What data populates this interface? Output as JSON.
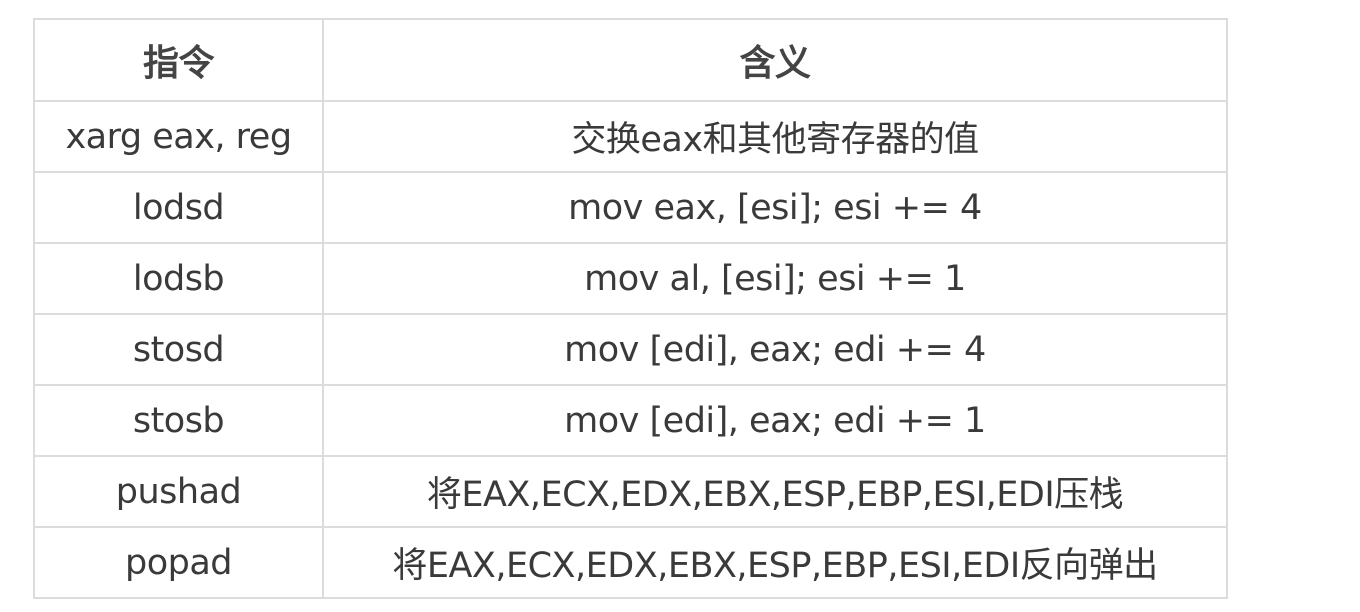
{
  "table": {
    "headers": [
      "指令",
      "含义"
    ],
    "rows": [
      [
        "xarg eax, reg",
        "交换eax和其他寄存器的值"
      ],
      [
        "lodsd",
        "mov eax, [esi]; esi += 4"
      ],
      [
        "lodsb",
        "mov al, [esi]; esi += 1"
      ],
      [
        "stosd",
        "mov [edi], eax; edi += 4"
      ],
      [
        "stosb",
        "mov [edi], eax; edi += 1"
      ],
      [
        "pushad",
        "将EAX,ECX,EDX,EBX,ESP,EBP,ESI,EDI压栈"
      ],
      [
        "popad",
        "将EAX,ECX,EDX,EBX,ESP,EBP,ESI,EDI反向弹出"
      ]
    ]
  }
}
